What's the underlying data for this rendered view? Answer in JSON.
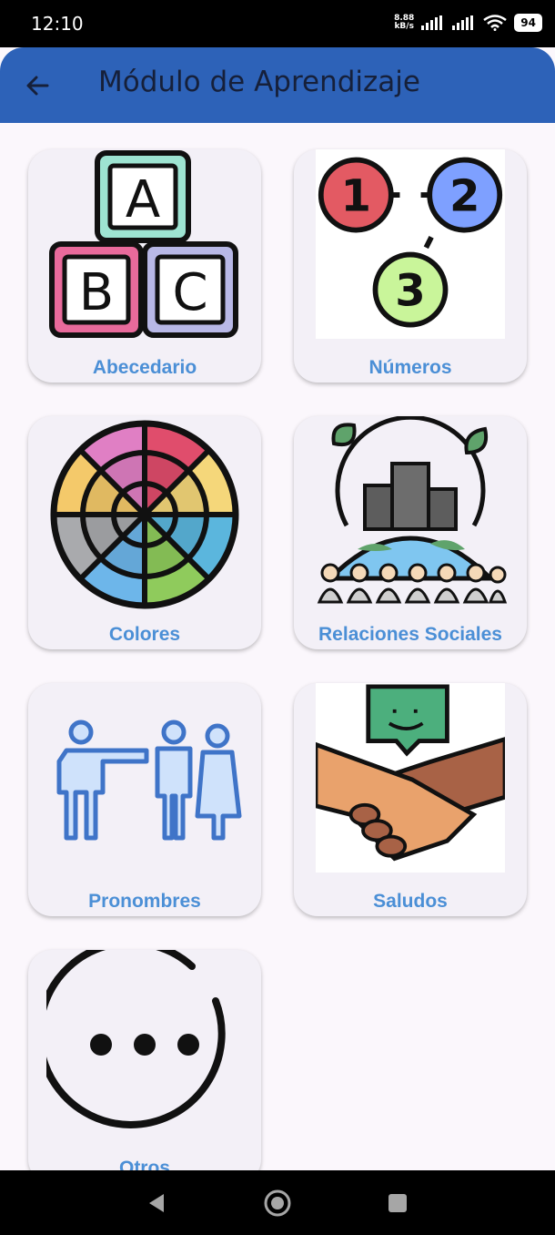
{
  "status": {
    "time": "12:10",
    "speed_value": "8.88",
    "speed_unit": "kB/s",
    "battery": "94"
  },
  "app_bar": {
    "title": "Módulo de Aprendizaje"
  },
  "cards": [
    {
      "label": "Abecedario",
      "blocks": [
        "A",
        "B",
        "C"
      ]
    },
    {
      "label": "Números",
      "digits": [
        "1",
        "2",
        "3"
      ]
    },
    {
      "label": "Colores"
    },
    {
      "label": "Relaciones Sociales"
    },
    {
      "label": "Pronombres"
    },
    {
      "label": "Saludos"
    },
    {
      "label": "Otros"
    }
  ],
  "colors": {
    "app_bar": "#2d62b8",
    "label": "#4b8fd6",
    "card_bg": "#f3f0f7",
    "page_bg": "#fbf7fc"
  }
}
